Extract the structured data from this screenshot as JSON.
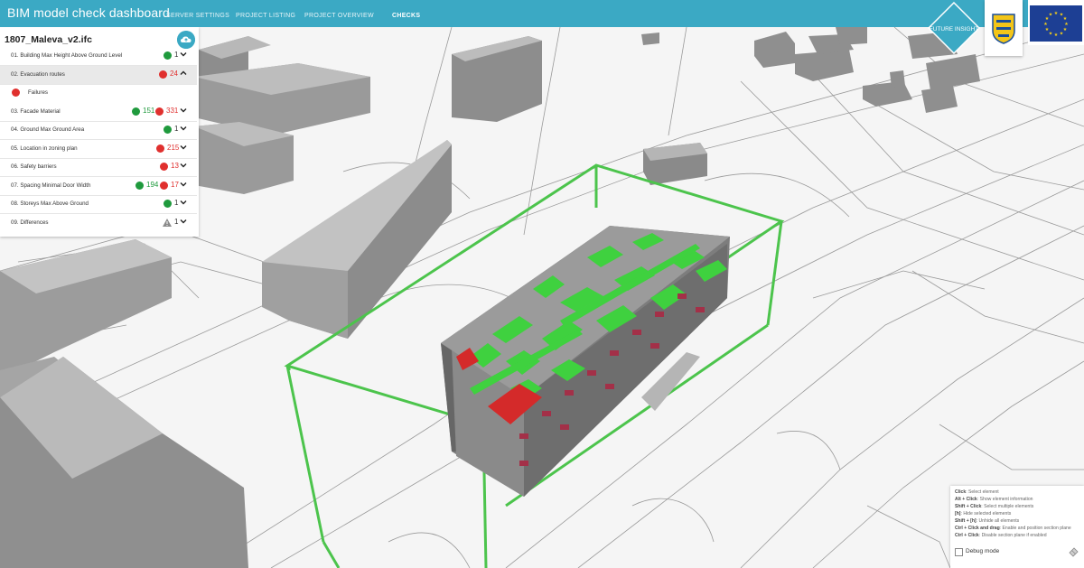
{
  "app": {
    "title": "BIM model check dashboard"
  },
  "nav": [
    {
      "label": "SERVER SETTINGS",
      "active": false
    },
    {
      "label": "PROJECT LISTING",
      "active": false
    },
    {
      "label": "PROJECT OVERVIEW",
      "active": false
    },
    {
      "label": "CHECKS",
      "active": true
    }
  ],
  "logos": {
    "future_insight": "FUTURE INSIGHT"
  },
  "panel": {
    "file_name": "1807_Maleva_v2.ifc",
    "checks": [
      {
        "label": "01. Building Max Height Above Ground Level",
        "passed": "1"
      },
      {
        "label": "02. Evacuation routes",
        "failed": "24",
        "expanded": true
      },
      {
        "label": "03. Facade Material",
        "passed": "151",
        "failed": "331"
      },
      {
        "label": "04. Ground Max Ground Area",
        "passed": "1"
      },
      {
        "label": "05. Location in zoning plan",
        "failed": "215"
      },
      {
        "label": "06. Safety barriers",
        "failed": "13"
      },
      {
        "label": "07. Spacing Minimal Door Width",
        "passed": "194",
        "failed": "17"
      },
      {
        "label": "08. Storeys Max Above Ground",
        "passed": "1"
      },
      {
        "label": "09. Differences",
        "warnings": "1"
      }
    ],
    "failures_label": "Failures"
  },
  "help": {
    "items": [
      {
        "key": "Click",
        "desc": ": Select element"
      },
      {
        "key": "Alt + Click",
        "desc": ": Show element information"
      },
      {
        "key": "Shift + Click",
        "desc": ": Select multiple elements"
      },
      {
        "key": "[h]",
        "desc": ": Hide selected elements"
      },
      {
        "key": "Shift + [h]",
        "desc": ": Unhide all elements"
      },
      {
        "key": "Ctrl + Click and drag",
        "desc": ": Enable and position section plane"
      },
      {
        "key": "Ctrl + Click",
        "desc": ": Disable section plane if enabled"
      }
    ],
    "debug_label": "Debug mode",
    "debug_checked": false
  },
  "colors": {
    "accent": "#3ba9c4",
    "pass": "#1f9a3d",
    "fail": "#e0302e",
    "highlight": "#3fd13f",
    "bbox": "#4cc44c"
  }
}
